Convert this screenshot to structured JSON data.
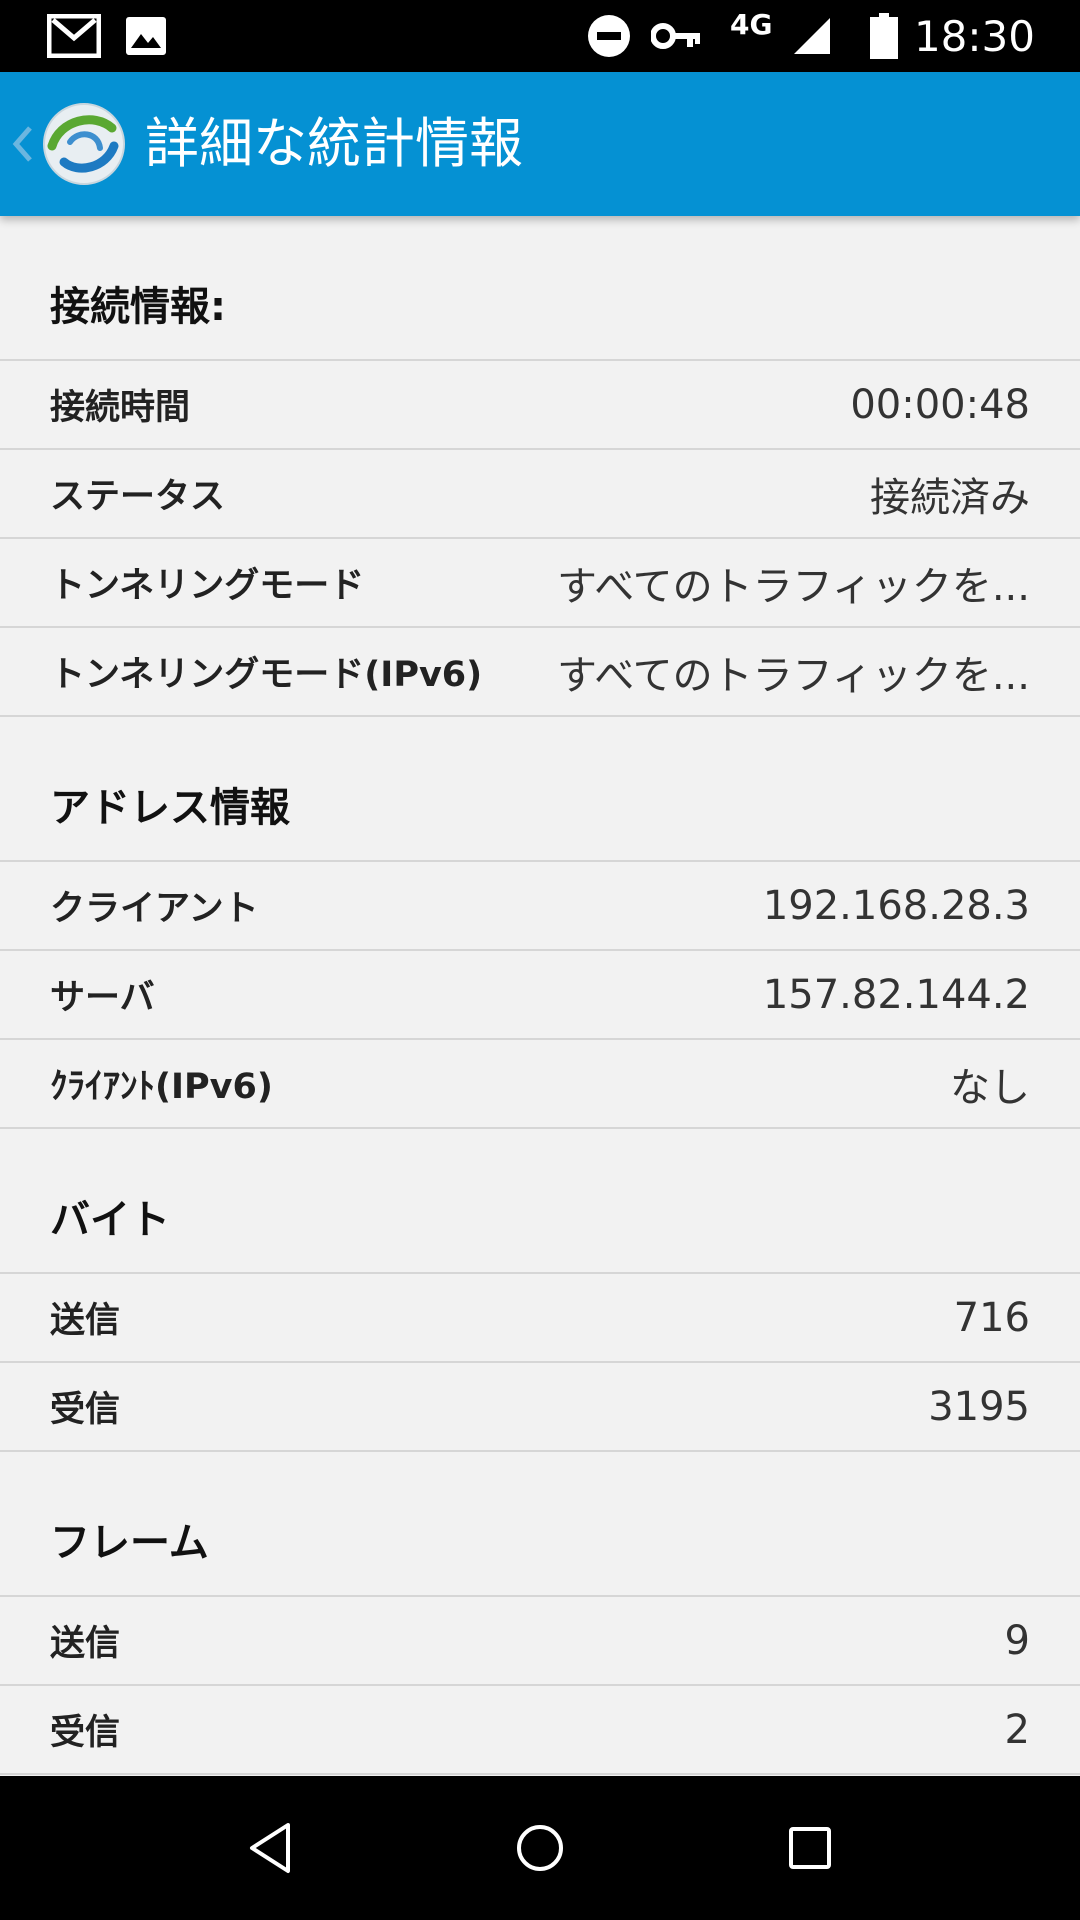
{
  "status_bar": {
    "time": "18:30",
    "network": "4G",
    "icons": [
      "gmail-icon",
      "gallery-icon",
      "do-not-disturb-icon",
      "vpn-key-icon",
      "signal-icon",
      "battery-icon"
    ]
  },
  "app_bar": {
    "title": "詳細な統計情報",
    "accent_color": "#0591d3"
  },
  "sections": {
    "connection": {
      "header": "接続情報:",
      "rows": [
        {
          "label": "接続時間",
          "value": "00:00:48"
        },
        {
          "label": "ステータス",
          "value": "接続済み"
        },
        {
          "label": "トンネリングモード",
          "value": "すべてのトラフィックを..."
        },
        {
          "label": "トンネリングモード(IPv6)",
          "value": "すべてのトラフィックを..."
        }
      ]
    },
    "address": {
      "header": "アドレス情報",
      "rows": [
        {
          "label": "クライアント",
          "value": "192.168.28.3"
        },
        {
          "label": "サーバ",
          "value": "157.82.144.2"
        },
        {
          "label": "ｸﾗｲｱﾝﾄ(IPv6)",
          "value": "なし"
        }
      ]
    },
    "bytes": {
      "header": "バイト",
      "rows": [
        {
          "label": "送信",
          "value": "716"
        },
        {
          "label": "受信",
          "value": "3195"
        }
      ]
    },
    "frames": {
      "header": "フレーム",
      "rows": [
        {
          "label": "送信",
          "value": "9"
        },
        {
          "label": "受信",
          "value": "2"
        }
      ]
    }
  },
  "nav_bar": {
    "buttons": [
      "back-nav-icon",
      "home-nav-icon",
      "recents-nav-icon"
    ]
  }
}
